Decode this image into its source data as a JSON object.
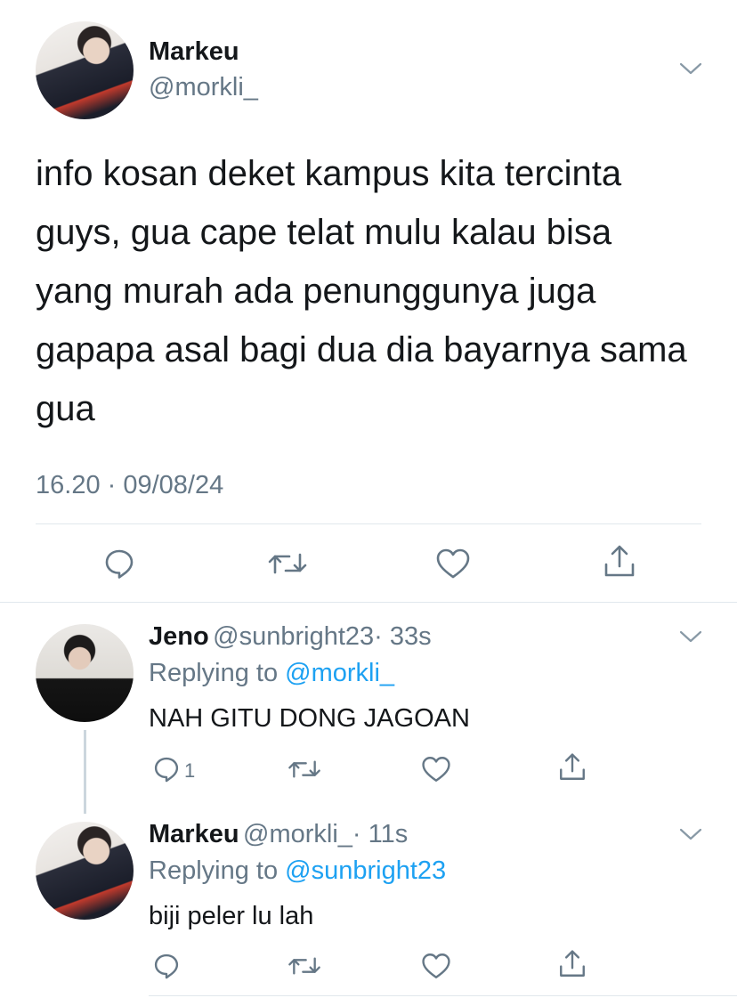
{
  "main_tweet": {
    "author_name": "Markeu",
    "author_handle": "@morkli_",
    "text": "info kosan deket kampus kita tercinta guys, gua cape telat mulu kalau bisa yang murah ada penunggunya juga gapapa asal bagi dua dia bayarnya sama gua",
    "timestamp": "16.20 · 09/08/24"
  },
  "replies": [
    {
      "author_name": "Jeno",
      "author_handle": "@sunbright23",
      "time": "· 33s",
      "replying_label": "Replying to",
      "replying_to": "@morkli_",
      "text": "NAH GITU DONG JAGOAN",
      "reply_count": "1"
    },
    {
      "author_name": "Markeu",
      "author_handle": "@morkli_",
      "time": "· 11s",
      "replying_label": "Replying to",
      "replying_to": "@sunbright23",
      "text": "biji peler lu lah",
      "reply_count": ""
    }
  ],
  "icons": {
    "reply": "reply-icon",
    "retweet": "retweet-icon",
    "like": "like-icon",
    "share": "share-icon",
    "more": "chevron-down-icon"
  },
  "colors": {
    "text": "#14171a",
    "secondary": "#657786",
    "link": "#1da1f2",
    "divider": "#e1e8ed"
  }
}
